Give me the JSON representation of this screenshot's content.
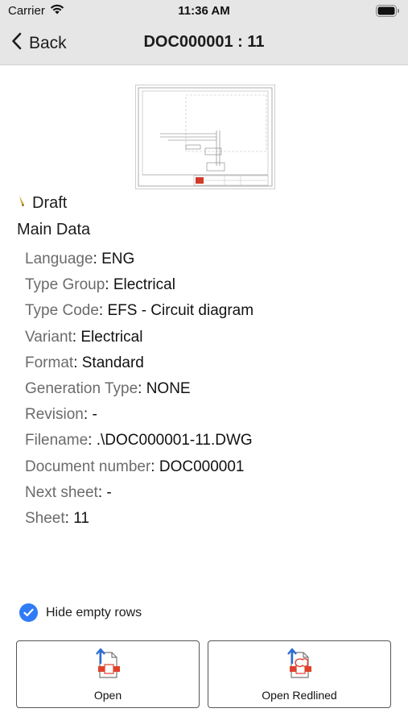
{
  "status_bar": {
    "carrier": "Carrier",
    "time": "11:36 AM"
  },
  "nav": {
    "back_label": "Back",
    "title": "DOC000001 : 11"
  },
  "document": {
    "status": "Draft",
    "section_title": "Main Data"
  },
  "fields": [
    {
      "label": "Language",
      "value": "ENG"
    },
    {
      "label": "Type Group",
      "value": "Electrical"
    },
    {
      "label": "Type Code",
      "value": "EFS - Circuit diagram"
    },
    {
      "label": "Variant",
      "value": "Electrical"
    },
    {
      "label": "Format",
      "value": "Standard"
    },
    {
      "label": "Generation Type",
      "value": "NONE"
    },
    {
      "label": "Revision",
      "value": "-"
    },
    {
      "label": "Filename",
      "value": ".\\DOC000001-11.DWG"
    },
    {
      "label": "Document number",
      "value": "DOC000001"
    },
    {
      "label": "Next sheet",
      "value": "-"
    },
    {
      "label": "Sheet",
      "value": "11"
    }
  ],
  "options": {
    "hide_empty_rows_label": "Hide empty rows",
    "hide_empty_rows_checked": true
  },
  "actions": {
    "open_label": "Open",
    "open_redlined_label": "Open Redlined"
  },
  "colors": {
    "accent": "#2f7cf6",
    "bar": "#e6e6e6",
    "doc_icon_red": "#e0412d",
    "doc_icon_blue": "#2b6fd6"
  },
  "icons": {
    "signal": "wifi-icon",
    "battery": "battery-icon",
    "back": "chevron-left-icon",
    "status": "pencil-icon",
    "check": "checkmark-icon",
    "open": "document-open-icon",
    "open_redlined": "document-redlined-icon"
  }
}
